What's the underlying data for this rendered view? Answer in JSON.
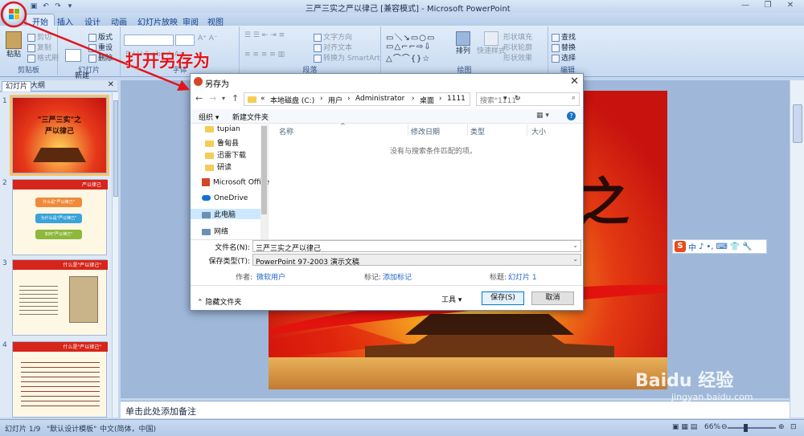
{
  "window": {
    "title": "三严三实之严以律己 [兼容模式] - Microsoft PowerPoint"
  },
  "ribbon": {
    "tabs": [
      "开始",
      "插入",
      "设计",
      "动画",
      "幻灯片放映",
      "审阅",
      "视图"
    ],
    "clipboard": {
      "paste": "粘贴",
      "cut": "剪切",
      "copy": "复制",
      "format_painter": "格式刷",
      "label": "剪贴板"
    },
    "slides": {
      "new_slide": "新建\n幻灯片",
      "layout": "版式",
      "reset": "重设",
      "delete": "删除",
      "label": "幻灯片"
    },
    "font": {
      "label": "字体"
    },
    "paragraph": {
      "text_direction": "文字方向",
      "align_text": "对齐文本",
      "convert_smartart": "转换为 SmartArt",
      "label": "段落"
    },
    "drawing": {
      "arrange": "排列",
      "quick_styles": "快速样式",
      "shape_fill": "形状填充",
      "shape_outline": "形状轮廓",
      "shape_effects": "形状效果",
      "label": "绘图"
    },
    "editing": {
      "find": "查找",
      "replace": "替换",
      "select": "选择",
      "label": "编辑"
    }
  },
  "pane": {
    "tabs": [
      "幻灯片",
      "大纲"
    ],
    "slides": [
      {
        "num": "1",
        "lines": [
          "\"三严三实\"之",
          "严以律己"
        ]
      },
      {
        "num": "2",
        "lines": [
          "严以律己",
          "什么是\"严以律己\"",
          "为什么是\"严以律己\"",
          "如何\"严以律己\""
        ]
      },
      {
        "num": "3",
        "lines": [
          "什么是\"严以律己\""
        ]
      },
      {
        "num": "4",
        "lines": [
          "什么是\"严以律己\""
        ]
      }
    ]
  },
  "slide_main": {
    "partial_char": "之"
  },
  "notes": {
    "placeholder": "单击此处添加备注"
  },
  "status": {
    "slide": "幻灯片 1/9",
    "theme": "\"默认设计模板\"",
    "lang": "中文(简体，中国)",
    "zoom": "66%"
  },
  "annotation": {
    "text": "打开另存为",
    "color": "#e0161c"
  },
  "ime": {
    "items": [
      "中",
      "♪",
      "•,",
      "⌨",
      "✈",
      "♣",
      "👕",
      "🔧"
    ]
  },
  "dialog": {
    "title": "另存为",
    "address": [
      "«",
      "本地磁盘 (C:)",
      "›",
      "用户",
      "›",
      "Administrator",
      "›",
      "桌面",
      "›",
      "1111"
    ],
    "search_placeholder": "搜索\"1111\"",
    "toolbar": {
      "organize": "组织 ▾",
      "new_folder": "新建文件夹"
    },
    "tree": [
      {
        "label": "tupian",
        "icon": "folder"
      },
      {
        "label": "鲁甸县",
        "icon": "folder"
      },
      {
        "label": "迅雷下载",
        "icon": "folder"
      },
      {
        "label": "研读",
        "icon": "folder"
      },
      {
        "label": "Microsoft Office",
        "icon": "office"
      },
      {
        "label": "OneDrive",
        "icon": "cloud"
      },
      {
        "label": "此电脑",
        "icon": "drive"
      },
      {
        "label": "网络",
        "icon": "drive"
      }
    ],
    "columns": [
      "名称",
      "修改日期",
      "类型",
      "大小"
    ],
    "empty_message": "没有与搜索条件匹配的项。",
    "filename_label": "文件名(N):",
    "filename_value": "三严三实之严以律己",
    "filetype_label": "保存类型(T):",
    "filetype_value": "PowerPoint 97-2003 演示文稿",
    "author_label": "作者:",
    "author_value": "微软用户",
    "tags_label": "标记:",
    "tags_value": "添加标记",
    "titlefield_label": "标题:",
    "titlefield_value": "幻灯片 1",
    "hide_folders": "隐藏文件夹",
    "tools": "工具",
    "save": "保存(S)",
    "cancel": "取消"
  }
}
